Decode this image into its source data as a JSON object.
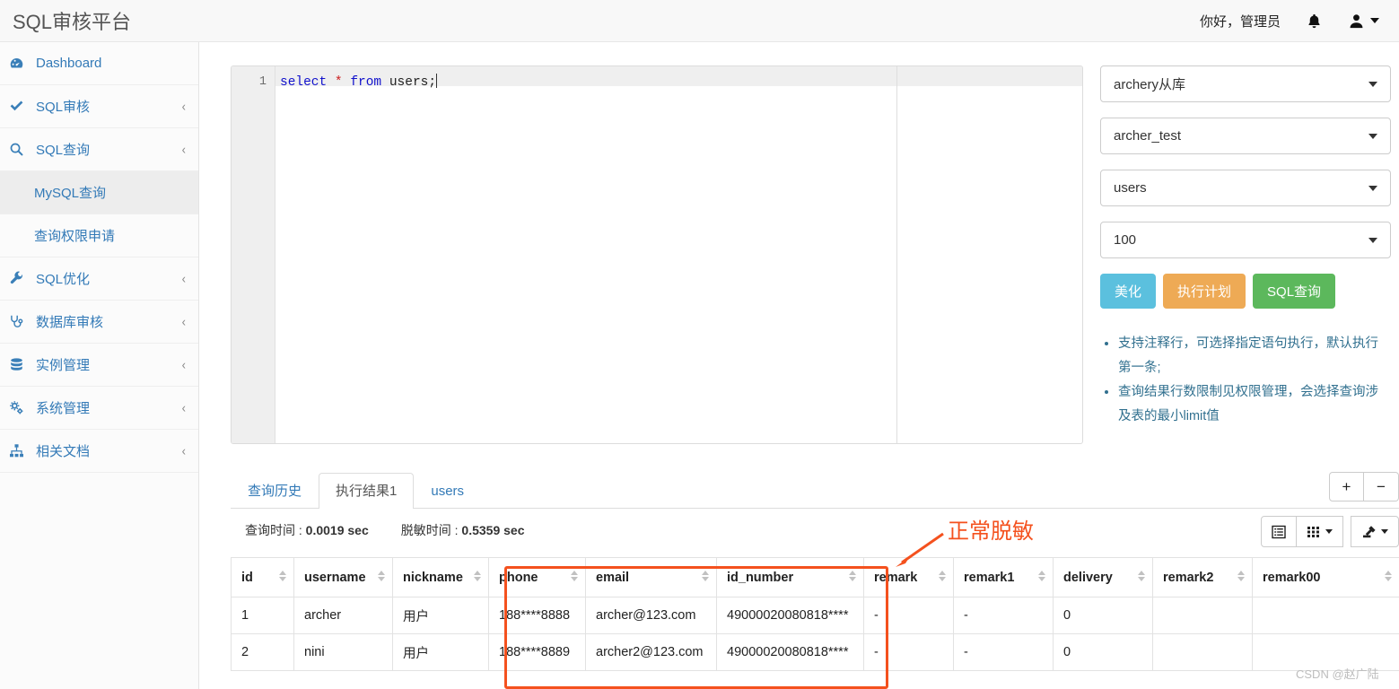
{
  "header": {
    "brand": "SQL审核平台",
    "greeting": "你好，管理员",
    "bell_icon": "bell-icon",
    "user_icon": "user-icon"
  },
  "sidebar": {
    "items": [
      {
        "label": "Dashboard",
        "icon": "dashboard-icon",
        "chevron": "",
        "active": false,
        "sub": false
      },
      {
        "label": "SQL审核",
        "icon": "check-icon",
        "chevron": "‹",
        "active": false,
        "sub": false
      },
      {
        "label": "SQL查询",
        "icon": "search-icon",
        "chevron": "‹",
        "active": false,
        "sub": false
      },
      {
        "label": "MySQL查询",
        "icon": "",
        "chevron": "",
        "active": true,
        "sub": true
      },
      {
        "label": "查询权限申请",
        "icon": "",
        "chevron": "",
        "active": false,
        "sub": true
      },
      {
        "label": "SQL优化",
        "icon": "wrench-icon",
        "chevron": "‹",
        "active": false,
        "sub": false
      },
      {
        "label": "数据库审核",
        "icon": "stethoscope-icon",
        "chevron": "‹",
        "active": false,
        "sub": false
      },
      {
        "label": "实例管理",
        "icon": "database-icon",
        "chevron": "‹",
        "active": false,
        "sub": false
      },
      {
        "label": "系统管理",
        "icon": "cogs-icon",
        "chevron": "‹",
        "active": false,
        "sub": false
      },
      {
        "label": "相关文档",
        "icon": "sitemap-icon",
        "chevron": "‹",
        "active": false,
        "sub": false
      }
    ]
  },
  "editor": {
    "line_number": "1",
    "code_keyword_select": "select",
    "code_star": " * ",
    "code_keyword_from": "from",
    "code_table": " users;"
  },
  "controls": {
    "instance": "archery从库",
    "database": "archer_test",
    "table": "users",
    "limit": "100",
    "buttons": [
      {
        "label": "美化",
        "color": "#5bc0de"
      },
      {
        "label": "执行计划",
        "color": "#eeaa55"
      },
      {
        "label": "SQL查询",
        "color": "#5cb85c"
      }
    ],
    "tips": [
      "支持注释行，可选择指定语句执行，默认执行第一条;",
      "查询结果行数限制见权限管理，会选择查询涉及表的最小limit值"
    ]
  },
  "results": {
    "tabs": [
      {
        "label": "查询历史",
        "active": false
      },
      {
        "label": "执行结果1",
        "active": true
      },
      {
        "label": "users",
        "active": false
      }
    ],
    "plus_label": "+",
    "minus_label": "−",
    "query_time_label": "查询时间 : ",
    "query_time_value": "0.0019 sec",
    "mask_time_label": "脱敏时间 : ",
    "mask_time_value": "0.5359 sec",
    "table_icons": [
      {
        "name": "column-list-icon"
      },
      {
        "name": "grid-view-icon"
      },
      {
        "name": "export-icon"
      }
    ],
    "columns": [
      "id",
      "username",
      "nickname",
      "phone",
      "email",
      "id_number",
      "remark",
      "remark1",
      "delivery",
      "remark2",
      "remark00"
    ],
    "rows": [
      [
        "1",
        "archer",
        "用户",
        "188****8888",
        "archer@123.com",
        "49000020080818****",
        "-",
        "-",
        "0",
        "",
        ""
      ],
      [
        "2",
        "nini",
        "用户",
        "188****8889",
        "archer2@123.com",
        "49000020080818****",
        "-",
        "-",
        "0",
        "",
        ""
      ]
    ]
  },
  "annotation": {
    "text": "正常脱敏",
    "color": "#f4511e"
  },
  "watermark": "CSDN @赵广陆"
}
